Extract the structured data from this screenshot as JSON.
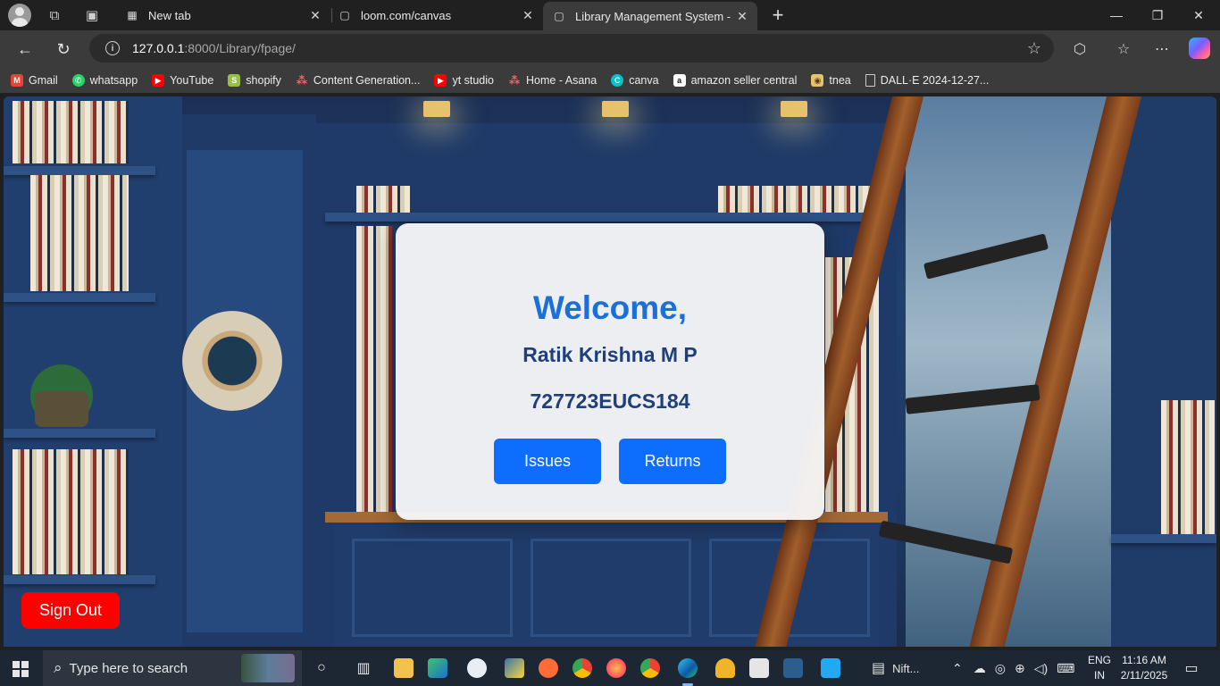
{
  "browser": {
    "tabs": [
      {
        "title": "New tab",
        "icon": "newtab-icon"
      },
      {
        "title": "loom.com/canvas",
        "icon": "page-icon"
      },
      {
        "title": "Library Management System - Fac",
        "icon": "page-icon",
        "active": true
      }
    ],
    "url_host": "127.0.0.1",
    "url_path": ":8000/Library/fpage/",
    "bookmarks": [
      {
        "label": "Gmail",
        "icon": "gmail-icon",
        "color": "#ea4335"
      },
      {
        "label": "whatsapp",
        "icon": "whatsapp-icon",
        "color": "#25d366"
      },
      {
        "label": "YouTube",
        "icon": "youtube-icon",
        "color": "#ff0000"
      },
      {
        "label": "shopify",
        "icon": "shopify-icon",
        "color": "#95bf47"
      },
      {
        "label": "Content Generation...",
        "icon": "asana-icon",
        "color": "#f06a6a"
      },
      {
        "label": "yt studio",
        "icon": "youtube-icon",
        "color": "#ff0000"
      },
      {
        "label": "Home - Asana",
        "icon": "asana-icon",
        "color": "#f06a6a"
      },
      {
        "label": "canva",
        "icon": "canva-icon",
        "color": "#00c4cc"
      },
      {
        "label": "amazon seller central",
        "icon": "amazon-icon",
        "color": "#111111"
      },
      {
        "label": "tnea",
        "icon": "tnea-icon",
        "color": "#e6c36a"
      },
      {
        "label": "DALL·E 2024-12-27...",
        "icon": "file-icon",
        "color": "#cccccc"
      }
    ]
  },
  "page": {
    "welcome": "Welcome,",
    "user_name": "Ratik Krishna M P",
    "user_id": "727723EUCS184",
    "issues_label": "Issues",
    "returns_label": "Returns",
    "signout_label": "Sign Out",
    "accent_color": "#0d6efd",
    "signout_color": "#ff0000"
  },
  "taskbar": {
    "search_placeholder": "Type here to search",
    "nift_label": "Nift...",
    "lang_top": "ENG",
    "lang_bottom": "IN",
    "time": "11:16 AM",
    "date": "2/11/2025"
  }
}
